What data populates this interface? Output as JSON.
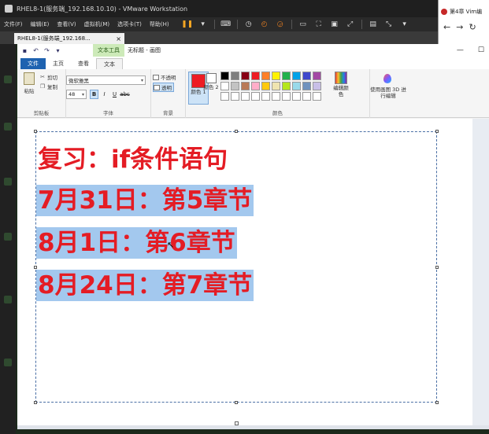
{
  "vmware": {
    "title": "RHEL8-1(服务端_192.168.10.10) - VMware Workstation",
    "menu": [
      "文件(F)",
      "编辑(E)",
      "查看(V)",
      "虚拟机(M)",
      "选项卡(T)",
      "帮助(H)"
    ],
    "vm_tab": "RHEL8-1(服务端_192.168..."
  },
  "browser": {
    "tab_title": "第4章 Vim编"
  },
  "paint": {
    "context_tab": "文本工具",
    "doc_title": "无标题 - 画图",
    "tabs": [
      "文件",
      "主页",
      "查看",
      "文本"
    ],
    "clipboard": {
      "paste": "粘贴",
      "cut": "剪切",
      "copy": "复制",
      "label": "剪贴板"
    },
    "font": {
      "family": "微软雅黑",
      "size": "48",
      "bold": "B",
      "italic": "I",
      "underline": "U",
      "strike": "abc",
      "label": "字体"
    },
    "background": {
      "opaque": "不透明",
      "transparent": "透明",
      "label": "背景"
    },
    "colors": {
      "color1_label": "颜色 1",
      "color2_label": "颜色 2",
      "edit_label": "编辑颜色",
      "label": "颜色",
      "color1": "#ed1c24",
      "color2": "#ffffff",
      "palette": [
        "#000000",
        "#7f7f7f",
        "#880015",
        "#ed1c24",
        "#ff7f27",
        "#fff200",
        "#22b14c",
        "#00a2e8",
        "#3f48cc",
        "#a349a4",
        "#ffffff",
        "#c3c3c3",
        "#b97a57",
        "#ffaec9",
        "#ffc90e",
        "#efe4b0",
        "#b5e61d",
        "#99d9ea",
        "#7092be",
        "#c8bfe7",
        "#ffffff",
        "#ffffff",
        "#ffffff",
        "#ffffff",
        "#ffffff",
        "#ffffff",
        "#ffffff",
        "#ffffff",
        "#ffffff",
        "#ffffff"
      ]
    },
    "paint3d": {
      "label": "使用画图 3D 进行编辑"
    },
    "canvas": {
      "lines": [
        "复习：if条件语句",
        "7月31日：第5章节",
        "8月1日：第6章节",
        "8月24日：第7章节"
      ]
    }
  }
}
